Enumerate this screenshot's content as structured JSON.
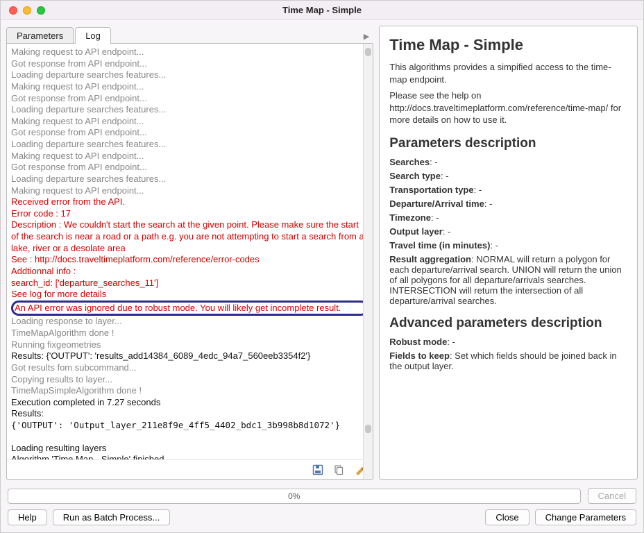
{
  "window": {
    "title": "Time Map - Simple"
  },
  "tabs": {
    "parameters": "Parameters",
    "log": "Log",
    "expand_hint": "▶"
  },
  "log": {
    "lines": [
      {
        "cls": "grey",
        "text": "Making request to API endpoint..."
      },
      {
        "cls": "grey",
        "text": "Got response from API endpoint..."
      },
      {
        "cls": "grey",
        "text": "Loading departure searches features..."
      },
      {
        "cls": "grey",
        "text": "Making request to API endpoint..."
      },
      {
        "cls": "grey",
        "text": "Got response from API endpoint..."
      },
      {
        "cls": "grey",
        "text": "Loading departure searches features..."
      },
      {
        "cls": "grey",
        "text": "Making request to API endpoint..."
      },
      {
        "cls": "grey",
        "text": "Got response from API endpoint..."
      },
      {
        "cls": "grey",
        "text": "Loading departure searches features..."
      },
      {
        "cls": "grey",
        "text": "Making request to API endpoint..."
      },
      {
        "cls": "grey",
        "text": "Got response from API endpoint..."
      },
      {
        "cls": "grey",
        "text": "Loading departure searches features..."
      },
      {
        "cls": "grey",
        "text": "Making request to API endpoint..."
      },
      {
        "cls": "red",
        "text": "Received error from the API."
      },
      {
        "cls": "red",
        "text": "Error code : 17"
      },
      {
        "cls": "red",
        "text": "Description : We couldn't start the search at the given point. Please make sure the start of the search is near a road or a path e.g. you are not attempting to start a search from a lake, river or a desolate area"
      },
      {
        "cls": "red",
        "text": "See : http://docs.traveltimeplatform.com/reference/error-codes"
      },
      {
        "cls": "red",
        "text": "Addtionnal info :"
      },
      {
        "cls": "red",
        "text": "search_id: ['departure_searches_11']"
      },
      {
        "cls": "red",
        "text": "See log for more details"
      },
      {
        "cls": "red highlight",
        "text": "An API error was ignored due to robust mode. You will likely get incomplete result."
      },
      {
        "cls": "grey",
        "text": "Loading response to layer..."
      },
      {
        "cls": "grey",
        "text": "TimeMapAlgorithm done !"
      },
      {
        "cls": "grey",
        "text": "Running fixgeometries"
      },
      {
        "cls": "black",
        "text": "Results: {'OUTPUT': 'results_add14384_6089_4edc_94a7_560eeb3354f2'}"
      },
      {
        "cls": "grey",
        "text": "Got results fom subcommand..."
      },
      {
        "cls": "grey",
        "text": "Copying results to layer..."
      },
      {
        "cls": "grey",
        "text": "TimeMapSimpleAlgorithm done !"
      },
      {
        "cls": "black",
        "text": "Execution completed in 7.27 seconds"
      },
      {
        "cls": "black",
        "text": "Results:"
      },
      {
        "cls": "black mono",
        "text": "{'OUTPUT': 'Output_layer_211e8f9e_4ff5_4402_bdc1_3b998b8d1072'}"
      },
      {
        "cls": "black",
        "text": " "
      },
      {
        "cls": "black",
        "text": "Loading resulting layers"
      },
      {
        "cls": "black",
        "text": "Algorithm 'Time Map - Simple' finished"
      }
    ]
  },
  "icons": {
    "save": "save-icon",
    "copy": "copy-icon",
    "clear": "clear-icon"
  },
  "progress": {
    "text": "0%"
  },
  "buttons": {
    "cancel": "Cancel",
    "help": "Help",
    "batch": "Run as Batch Process...",
    "close": "Close",
    "change": "Change Parameters"
  },
  "help": {
    "title": "Time Map - Simple",
    "intro1": "This algorithms provides a simpified access to the time-map endpoint.",
    "intro2": "Please see the help on http://docs.traveltimeplatform.com/reference/time-map/ for more details on how to use it.",
    "params_h": "Parameters description",
    "params": [
      {
        "label": "Searches",
        "desc": ": -"
      },
      {
        "label": "Search type",
        "desc": ": -"
      },
      {
        "label": "Transportation type",
        "desc": ": -"
      },
      {
        "label": "Departure/Arrival time",
        "desc": ": -"
      },
      {
        "label": "Timezone",
        "desc": ": -"
      },
      {
        "label": "Output layer",
        "desc": ": -"
      },
      {
        "label": "Travel time (in minutes)",
        "desc": ": -"
      },
      {
        "label": "Result aggregation",
        "desc": ": NORMAL will return a polygon for each departure/arrival search. UNION will return the union of all polygons for all departure/arrivals searches. INTERSECTION will return the intersection of all departure/arrival searches."
      }
    ],
    "adv_h": "Advanced parameters description",
    "adv": [
      {
        "label": "Robust mode",
        "desc": ": -"
      },
      {
        "label": "Fields to keep",
        "desc": ": Set which fields should be joined back in the output layer."
      }
    ]
  }
}
